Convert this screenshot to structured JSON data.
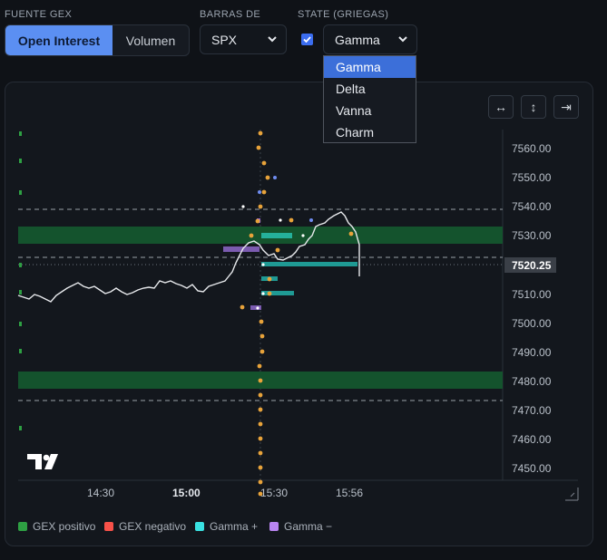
{
  "controls": {
    "fuente_label": "FUENTE GEX",
    "fuente_options": [
      "Open Interest",
      "Volumen"
    ],
    "barras_label": "BARRAS DE",
    "barras_value": "SPX",
    "state_label": "STATE (GRIEGAS)",
    "state_checked": true,
    "state_value": "Gamma",
    "state_options": [
      "Gamma",
      "Delta",
      "Vanna",
      "Charm"
    ]
  },
  "chart_tools": {
    "fit_horizontal": "↔",
    "fit_vertical": "↕",
    "scroll_right": "⇥"
  },
  "chart_data": {
    "type": "line",
    "price_axis": [
      "7560.00",
      "7550.00",
      "7540.00",
      "7530.00",
      "7520.25",
      "7510.00",
      "7500.00",
      "7490.00",
      "7480.00",
      "7470.00",
      "7460.00",
      "7450.00"
    ],
    "time_axis": [
      "14:30",
      "15:00",
      "15:30",
      "15:56"
    ],
    "last_price": "7520.25",
    "logo": "TV"
  },
  "legend": [
    {
      "label": "GEX positivo",
      "color": "#2ea043"
    },
    {
      "label": "GEX negativo",
      "color": "#f85149"
    },
    {
      "label": "Gamma +",
      "color": "#39e1e1"
    },
    {
      "label": "Gamma −",
      "color": "#b884f0"
    }
  ]
}
